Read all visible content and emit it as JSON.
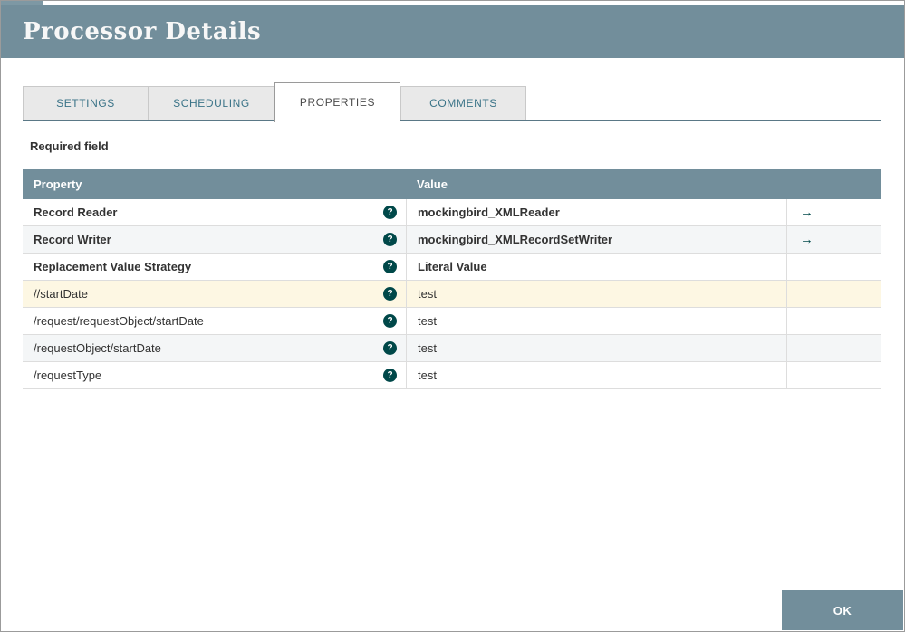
{
  "header": {
    "title": "Processor Details"
  },
  "tabs": [
    {
      "label": "SETTINGS"
    },
    {
      "label": "SCHEDULING"
    },
    {
      "label": "PROPERTIES"
    },
    {
      "label": "COMMENTS"
    }
  ],
  "active_tab": "PROPERTIES",
  "required_field_label": "Required field",
  "table": {
    "columns": [
      "Property",
      "Value"
    ],
    "help_icon": "?",
    "goto_icon": "→",
    "rows": [
      {
        "property": "Record Reader",
        "value": "mockingbird_XMLReader",
        "bold": true,
        "has_goto": true,
        "highlight": ""
      },
      {
        "property": "Record Writer",
        "value": "mockingbird_XMLRecordSetWriter",
        "bold": true,
        "has_goto": true,
        "highlight": ""
      },
      {
        "property": "Replacement Value Strategy",
        "value": "Literal Value",
        "bold": true,
        "has_goto": false,
        "highlight": ""
      },
      {
        "property": "//startDate",
        "value": "test",
        "bold": false,
        "has_goto": false,
        "highlight": "yellow"
      },
      {
        "property": "/request/requestObject/startDate",
        "value": "test",
        "bold": false,
        "has_goto": false,
        "highlight": ""
      },
      {
        "property": "/requestObject/startDate",
        "value": "test",
        "bold": false,
        "has_goto": false,
        "highlight": ""
      },
      {
        "property": "/requestType",
        "value": "test",
        "bold": false,
        "has_goto": false,
        "highlight": ""
      }
    ]
  },
  "footer": {
    "ok_label": "OK"
  },
  "colors": {
    "header_bg": "#728E9B",
    "table_header_bg": "#728E9B",
    "accent_dark": "#004849",
    "highlight_row": "#FDF7E3",
    "tab_text": "#3B7488",
    "ok_bg": "#728E9B"
  }
}
